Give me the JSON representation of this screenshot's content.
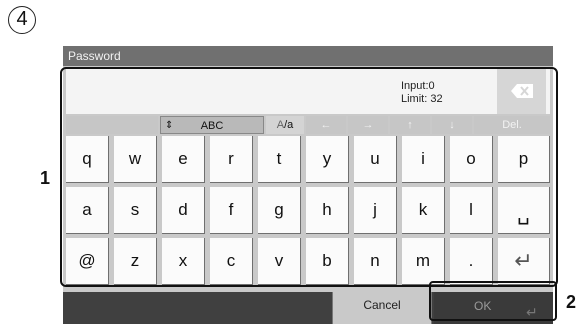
{
  "step_marker": "4",
  "title": "Password",
  "input": {
    "line1": "Input:0",
    "line2": "Limit: 32"
  },
  "toolbar": {
    "abc": "ABC",
    "case_a": "A",
    "case_b": "/a",
    "del": "Del."
  },
  "rows": [
    [
      "q",
      "w",
      "e",
      "r",
      "t",
      "y",
      "u",
      "i",
      "o",
      "p"
    ],
    [
      "a",
      "s",
      "d",
      "f",
      "g",
      "h",
      "j",
      "k",
      "l"
    ],
    [
      "@",
      "z",
      "x",
      "c",
      "v",
      "b",
      "n",
      "m",
      "."
    ]
  ],
  "space_label": "␣",
  "enter_label": "↵",
  "arrows": {
    "left": "←",
    "right": "→",
    "up": "↑",
    "down": "↓"
  },
  "bottom": {
    "cancel": "Cancel",
    "ok": "OK"
  },
  "callouts": {
    "one": "1",
    "two": "2"
  },
  "colors": {
    "key_bg": "#fbfbfb",
    "panel_bg": "#c9c9c9",
    "title_bg": "#707070",
    "control_bar": "#404040"
  }
}
